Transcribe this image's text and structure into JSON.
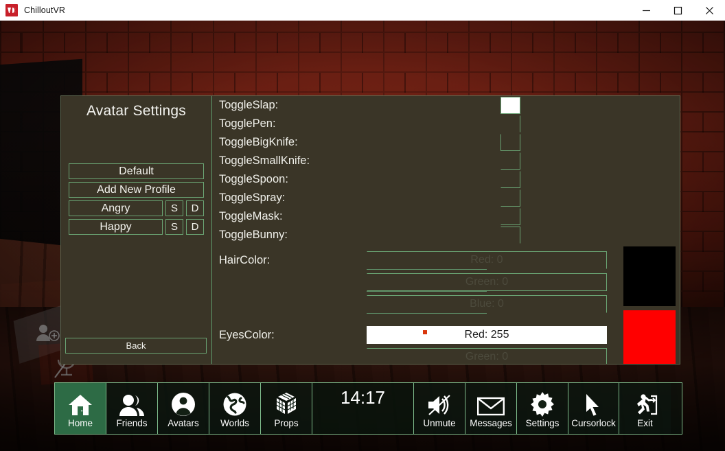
{
  "window": {
    "title": "ChilloutVR",
    "icon": "chilloutvr-logo",
    "controls": {
      "minimize": "—",
      "maximize": "□",
      "close": "✕"
    }
  },
  "menu": {
    "left": {
      "title": "Avatar Settings",
      "profiles": [
        {
          "label": "Default",
          "has_actions": false
        },
        {
          "label": "Add New Profile",
          "has_actions": false
        },
        {
          "label": "Angry",
          "has_actions": true,
          "save": "S",
          "delete": "D"
        },
        {
          "label": "Happy",
          "has_actions": true,
          "save": "S",
          "delete": "D"
        }
      ],
      "back_label": "Back"
    },
    "right": {
      "toggles": [
        {
          "label": "ToggleSlap:",
          "checked": true
        },
        {
          "label": "TogglePen:",
          "checked": false
        },
        {
          "label": "ToggleBigKnife:",
          "checked": false
        },
        {
          "label": "ToggleSmallKnife:",
          "checked": false
        },
        {
          "label": "ToggleSpoon:",
          "checked": false
        },
        {
          "label": "ToggleSpray:",
          "checked": false
        },
        {
          "label": "ToggleMask:",
          "checked": false
        },
        {
          "label": "ToggleBunny:",
          "checked": false
        }
      ],
      "colors": [
        {
          "label": "HairColor:",
          "swatch_hex": "#000000",
          "sliders": [
            {
              "channel": "Red",
              "value": 0,
              "display": "Red: 0",
              "fill": 0
            },
            {
              "channel": "Green",
              "value": 0,
              "display": "Green: 0",
              "fill": 0
            },
            {
              "channel": "Blue",
              "value": 0,
              "display": "Blue: 0",
              "fill": 0
            }
          ]
        },
        {
          "label": "EyesColor:",
          "swatch_hex": "#FF0000",
          "sliders": [
            {
              "channel": "Red",
              "value": 255,
              "display": "Red: 255",
              "fill": 100
            },
            {
              "channel": "Green",
              "value": 0,
              "display": "Green: 0",
              "fill": 0
            }
          ]
        }
      ]
    }
  },
  "taskbar": {
    "clock": "14:17",
    "items": [
      {
        "label": "Home",
        "icon": "house-icon",
        "active": true
      },
      {
        "label": "Friends",
        "icon": "people-icon",
        "active": false
      },
      {
        "label": "Avatars",
        "icon": "person-circle-icon",
        "active": false
      },
      {
        "label": "Worlds",
        "icon": "globe-icon",
        "active": false
      },
      {
        "label": "Props",
        "icon": "cube-icon",
        "active": false
      }
    ],
    "items_right": [
      {
        "label": "Unmute",
        "icon": "speaker-muted-icon",
        "active": false
      },
      {
        "label": "Messages",
        "icon": "envelope-icon",
        "active": false
      },
      {
        "label": "Settings",
        "icon": "gear-icon",
        "active": false
      },
      {
        "label": "Cursorlock",
        "icon": "cursor-arrow-icon",
        "active": false
      },
      {
        "label": "Exit",
        "icon": "exit-door-icon",
        "active": false
      }
    ]
  },
  "theme": {
    "panel_bg": "#3A3527",
    "panel_border": "#6AA574",
    "accent_green": "#2D6B45",
    "cursor_dot": "#D9360C",
    "text": "#F0F0EA"
  }
}
